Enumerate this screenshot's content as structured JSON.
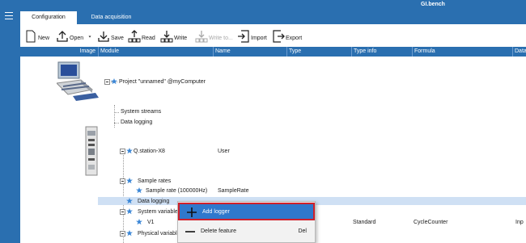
{
  "app": {
    "title": "GI.bench"
  },
  "tabs": [
    {
      "label": "Configuration",
      "active": true
    },
    {
      "label": "Data acquisition",
      "active": false
    }
  ],
  "toolbar": {
    "new_label": "New",
    "open_label": "Open",
    "save_label": "Save",
    "read_label": "Read",
    "write_label": "Write",
    "write_to_label": "Write to...",
    "import_label": "Import",
    "export_label": "Export"
  },
  "columns": [
    "Image",
    "Module",
    "Name",
    "Type",
    "Type info",
    "Formula",
    "Data"
  ],
  "tree": {
    "project": "Project \"unnamed\" @myComputer",
    "system_streams": "System streams",
    "data_logging_top": "Data logging",
    "qstation": "Q.station-X8",
    "qstation_name": "User",
    "sample_rates": "Sample rates",
    "sample_rate_item": "Sample rate (100000Hz)",
    "sample_rate_name": "SampleRate",
    "data_logging": "Data logging",
    "system_variables": "System variables",
    "v1": "V1",
    "v1_type": "Standard",
    "v1_formula": "CycleCounter",
    "v1_data": "Inp",
    "physical_variables": "Physical variables"
  },
  "context_menu": {
    "add_logger": "Add logger",
    "delete_feature": "Delete feature",
    "delete_shortcut": "Del"
  },
  "colors": {
    "accent": "#2a6fb0",
    "selection": "#2f78cc",
    "highlight_border": "#d0202a",
    "row_highlight": "#cfe0f4",
    "star": "#3a86d6"
  }
}
